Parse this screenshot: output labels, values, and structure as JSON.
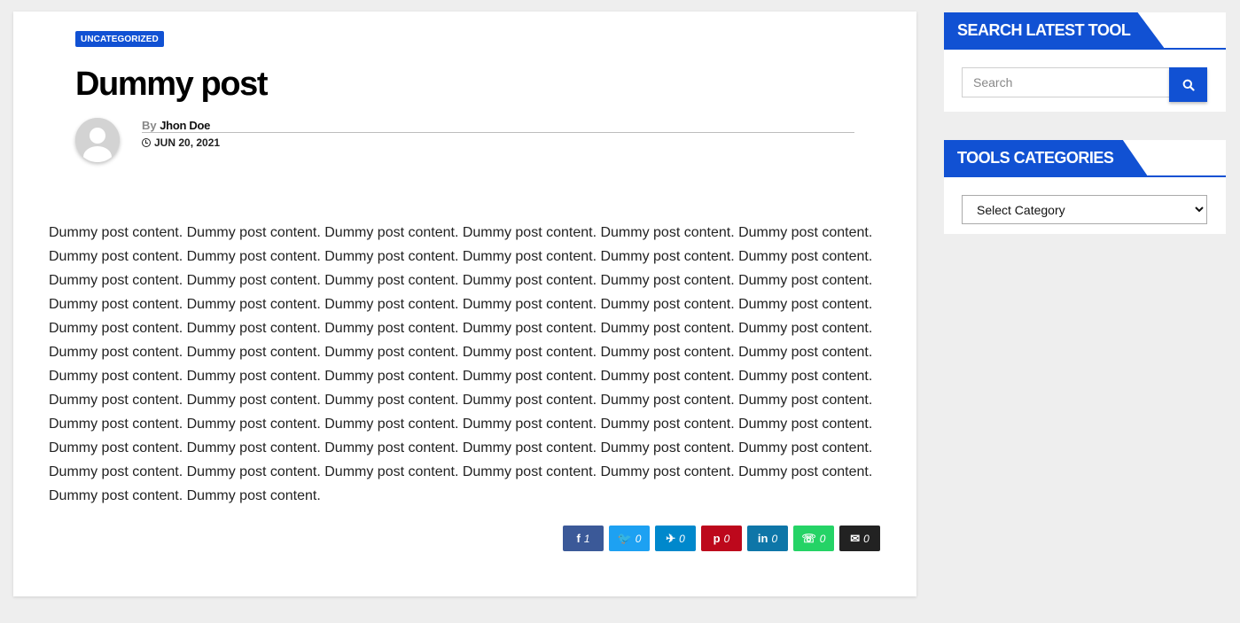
{
  "post": {
    "category": "UNCATEGORIZED",
    "title": "Dummy post",
    "by_label": "By",
    "author": "Jhon Doe",
    "date": "JUN 20, 2021",
    "content": "Dummy post content. Dummy post content. Dummy post content. Dummy post content. Dummy post content. Dummy post content. Dummy post content. Dummy post content. Dummy post content. Dummy post content. Dummy post content. Dummy post content. Dummy post content. Dummy post content. Dummy post content. Dummy post content. Dummy post content. Dummy post content. Dummy post content. Dummy post content. Dummy post content. Dummy post content. Dummy post content. Dummy post content. Dummy post content. Dummy post content. Dummy post content. Dummy post content. Dummy post content. Dummy post content. Dummy post content. Dummy post content. Dummy post content. Dummy post content. Dummy post content. Dummy post content. Dummy post content. Dummy post content. Dummy post content. Dummy post content. Dummy post content. Dummy post content. Dummy post content. Dummy post content. Dummy post content. Dummy post content. Dummy post content. Dummy post content. Dummy post content. Dummy post content. Dummy post content. Dummy post content. Dummy post content. Dummy post content. Dummy post content. Dummy post content. Dummy post content. Dummy post content. Dummy post content. Dummy post content. Dummy post content. Dummy post content. Dummy post content. Dummy post content. Dummy post content. Dummy post content. Dummy post content. Dummy post content."
  },
  "share": [
    {
      "network": "facebook",
      "icon": "facebook-icon",
      "glyph": "f",
      "count": "1",
      "color": "#3b5998"
    },
    {
      "network": "twitter",
      "icon": "twitter-icon",
      "glyph": "🐦",
      "count": "0",
      "color": "#1da1f2"
    },
    {
      "network": "telegram",
      "icon": "telegram-icon",
      "glyph": "✈",
      "count": "0",
      "color": "#0088cc"
    },
    {
      "network": "pinterest",
      "icon": "pinterest-icon",
      "glyph": "p",
      "count": "0",
      "color": "#bd081c"
    },
    {
      "network": "linkedin",
      "icon": "linkedin-icon",
      "glyph": "in",
      "count": "0",
      "color": "#0e76a8"
    },
    {
      "network": "whatsapp",
      "icon": "whatsapp-icon",
      "glyph": "☏",
      "count": "0",
      "color": "#25d366"
    },
    {
      "network": "email",
      "icon": "envelope-icon",
      "glyph": "✉",
      "count": "0",
      "color": "#222222"
    }
  ],
  "sidebar": {
    "search_title": "SEARCH LATEST TOOL",
    "search_placeholder": "Search",
    "categories_title": "TOOLS CATEGORIES",
    "categories_selected": "Select Category"
  },
  "colors": {
    "accent": "#1151d3",
    "background": "#eeeeee"
  }
}
